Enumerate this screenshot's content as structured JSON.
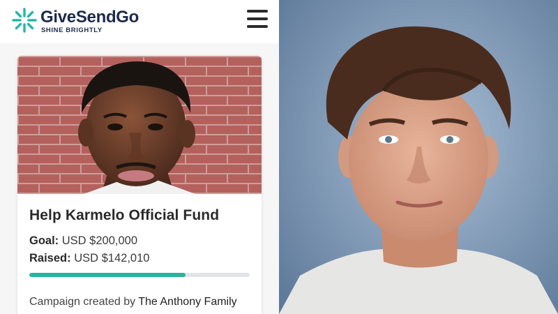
{
  "header": {
    "logo_name": "GiveSendGo",
    "logo_tagline": "SHINE BRIGHTLY",
    "brand_color": "#1e2a4a",
    "accent_color": "#25b59b"
  },
  "campaign": {
    "title": "Help Karmelo Official Fund",
    "goal_label": "Goal:",
    "goal_value": "USD $200,000",
    "raised_label": "Raised:",
    "raised_value": "USD $142,010",
    "progress_fraction": 0.71,
    "creator_prefix": "Campaign created by",
    "creator_name": "The Anthony Family"
  },
  "icons": {
    "logo": "starburst-logo-icon",
    "menu": "hamburger-menu-icon"
  }
}
